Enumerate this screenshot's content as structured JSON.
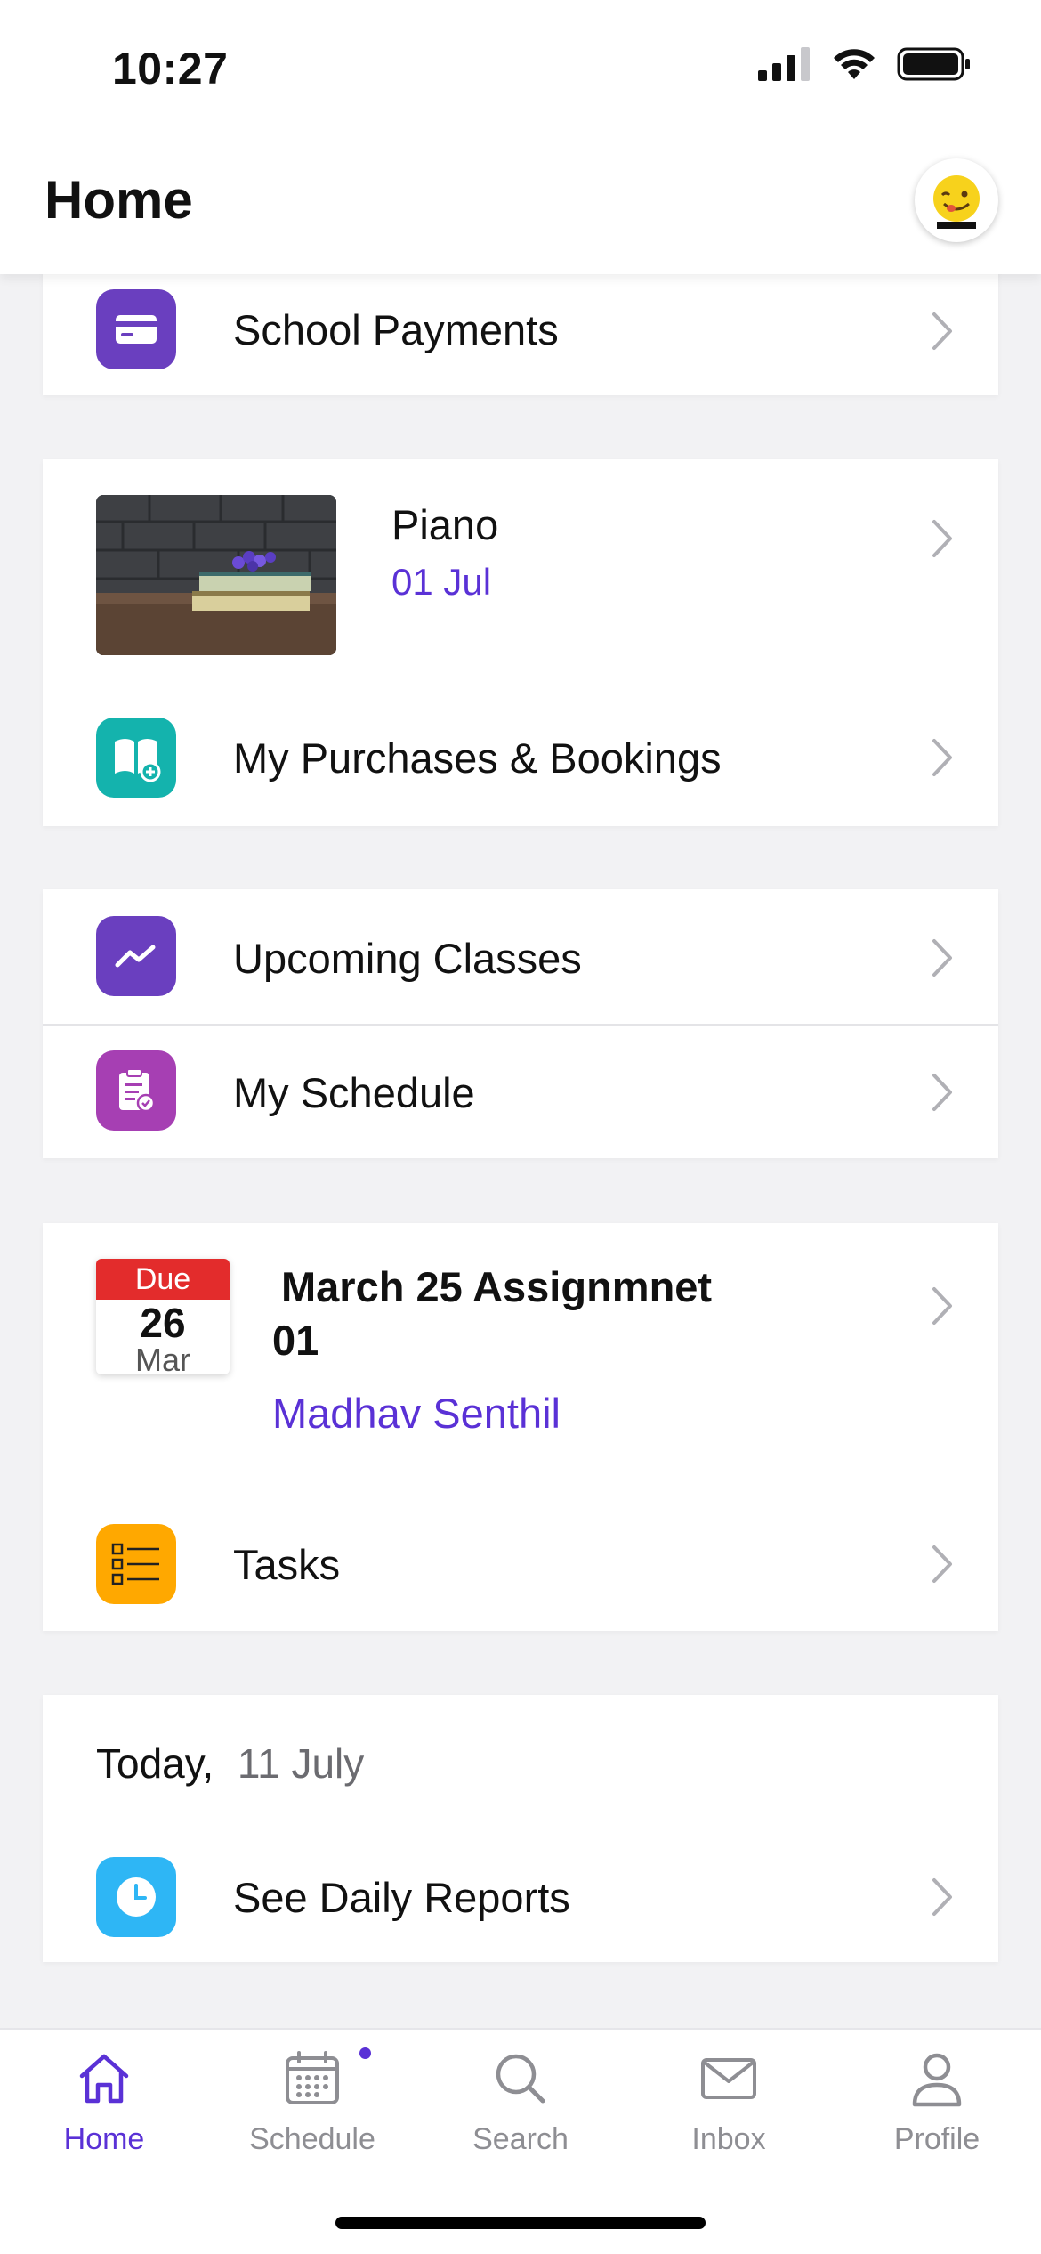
{
  "status_bar": {
    "time": "10:27"
  },
  "header": {
    "title": "Home"
  },
  "cards": {
    "payments": {
      "label": "School Payments"
    },
    "purchase": {
      "item_title": "Piano",
      "item_date": "01 Jul",
      "link_label": "My Purchases & Bookings"
    },
    "classes": {
      "upcoming_label": "Upcoming Classes",
      "schedule_label": "My Schedule"
    },
    "tasks": {
      "due_badge": "Due",
      "due_day": "26",
      "due_month": "Mar",
      "assignment_title_line1": "March 25 Assignmnet",
      "assignment_title_line2": "01",
      "assignee": "Madhav Senthil",
      "link_label": "Tasks"
    },
    "reports": {
      "today_label": "Today,",
      "today_date": "11 July",
      "link_label": "See Daily Reports"
    }
  },
  "tabbar": {
    "tabs": [
      {
        "label": "Home",
        "icon": "home-icon",
        "active": true
      },
      {
        "label": "Schedule",
        "icon": "calendar-icon",
        "active": false,
        "has_dot": true
      },
      {
        "label": "Search",
        "icon": "search-icon",
        "active": false
      },
      {
        "label": "Inbox",
        "icon": "mail-icon",
        "active": false
      },
      {
        "label": "Profile",
        "icon": "person-icon",
        "active": false
      }
    ]
  },
  "colors": {
    "accent": "#5a31d6",
    "payments_icon": "#6a3fbf",
    "purchases_icon": "#14b3ad",
    "upcoming_icon": "#6a3fbf",
    "schedule_icon": "#a63fb3",
    "tasks_icon": "#ffa800",
    "reports_icon": "#2eb6f5",
    "due_red": "#e32c2c"
  }
}
